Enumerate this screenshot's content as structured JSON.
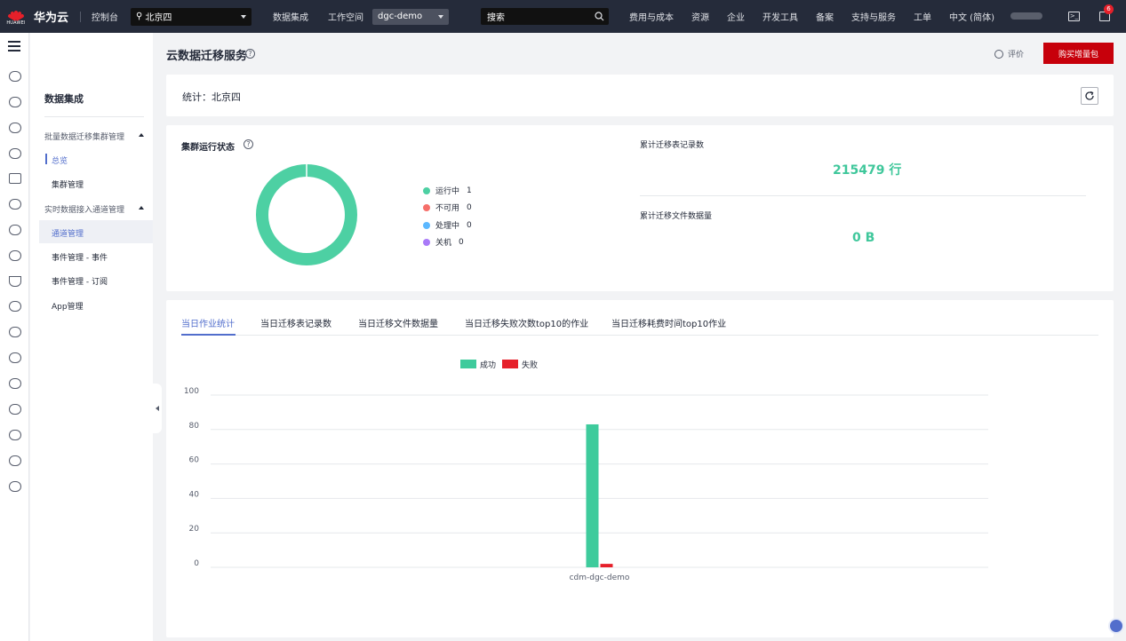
{
  "topnav": {
    "brand": "华为云",
    "logo_text": "HUAWEI",
    "console": "控制台",
    "region": "北京四",
    "data_integration": "数据集成",
    "workspace_label": "工作空间",
    "workspace_value": "dgc-demo",
    "search_placeholder": "搜索",
    "right_items": [
      "费用与成本",
      "资源",
      "企业",
      "开发工具",
      "备案",
      "支持与服务",
      "工单",
      "中文 (简体)"
    ],
    "notification_count": "6"
  },
  "sidebar": {
    "title": "数据集成",
    "group1": "批量数据迁移集群管理",
    "item_overview": "总览",
    "item_cluster": "集群管理",
    "group2": "实时数据接入通道管理",
    "item_channel": "通道管理",
    "item_event": "事件管理 - 事件",
    "item_subscribe": "事件管理 - 订阅",
    "item_app": "App管理"
  },
  "header": {
    "title": "云数据迁移服务",
    "rate": "评价",
    "buy": "购买增量包"
  },
  "stats": {
    "title": "统计：北京四"
  },
  "cluster": {
    "title": "集群运行状态",
    "legend": [
      {
        "label": "运行中",
        "value": "1",
        "color": "#4dd0a3"
      },
      {
        "label": "不可用",
        "value": "0",
        "color": "#f66f6a"
      },
      {
        "label": "处理中",
        "value": "0",
        "color": "#5cb8ff"
      },
      {
        "label": "关机",
        "value": "0",
        "color": "#a97af8"
      }
    ],
    "records_label": "累计迁移表记录数",
    "records_value": "215479 行",
    "files_label": "累计迁移文件数据量",
    "files_value": "0 B"
  },
  "tabs": [
    "当日作业统计",
    "当日迁移表记录数",
    "当日迁移文件数据量",
    "当日迁移失败次数top10的作业",
    "当日迁移耗费时间top10作业"
  ],
  "chart_data": {
    "type": "bar",
    "categories": [
      "cdm-dgc-demo"
    ],
    "series": [
      {
        "name": "成功",
        "values": [
          83
        ],
        "color": "#3ecb9c"
      },
      {
        "name": "失败",
        "values": [
          2
        ],
        "color": "#e6202a"
      }
    ],
    "ylim": [
      0,
      100
    ],
    "yticks": [
      "0",
      "20",
      "40",
      "60",
      "80",
      "100"
    ],
    "legend": "top-center",
    "grid": true
  }
}
